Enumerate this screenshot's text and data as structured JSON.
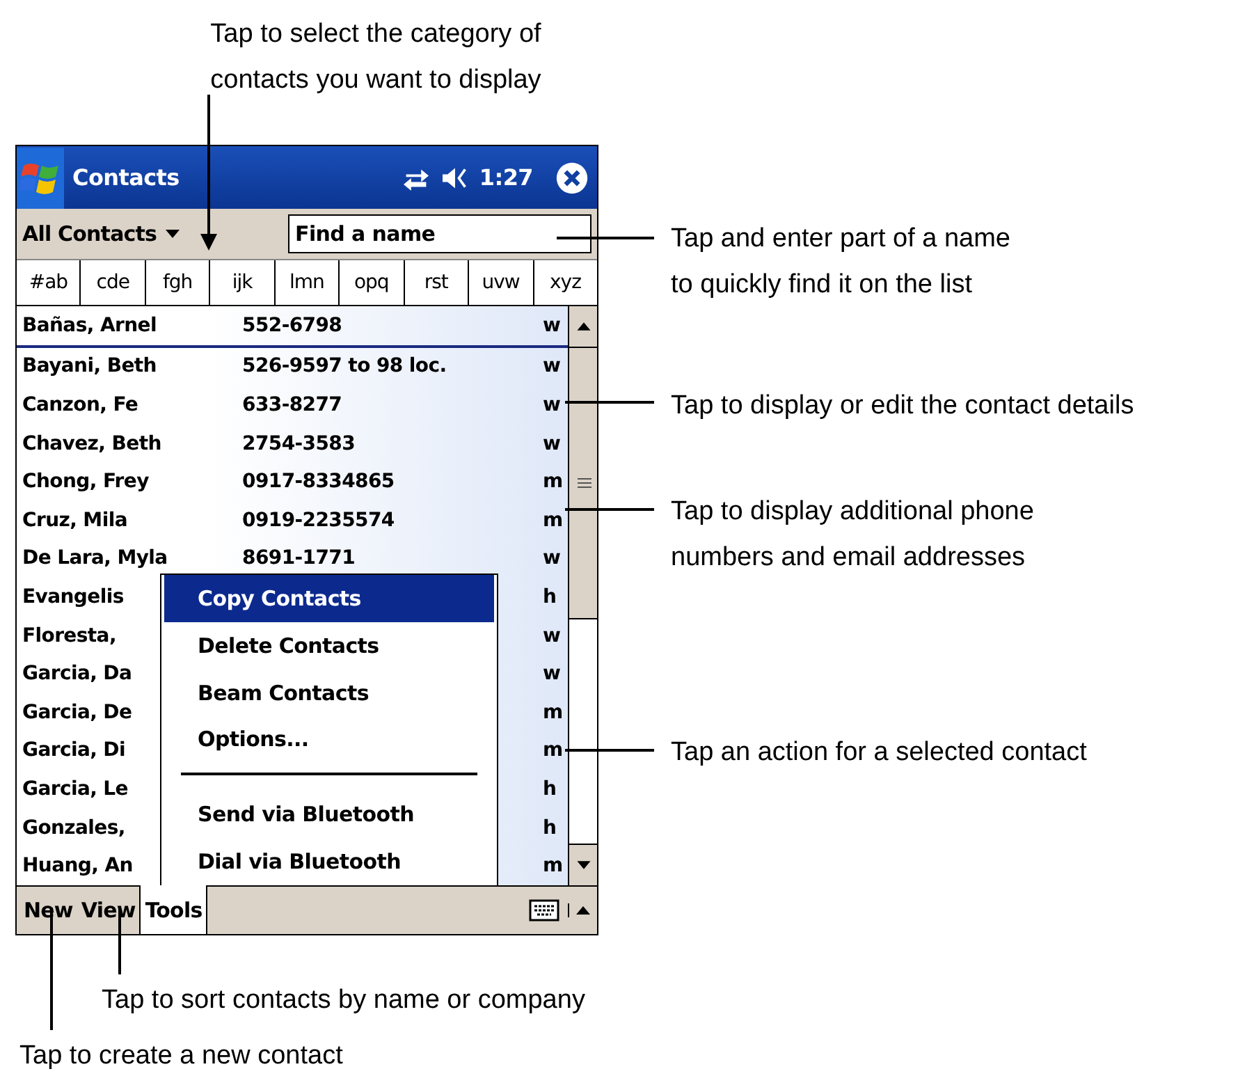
{
  "title_bar": {
    "title": "Contacts",
    "time": "1:27"
  },
  "filter": {
    "category": "All Contacts",
    "search": {
      "placeholder": "Find a name"
    }
  },
  "letter_tabs": [
    "#ab",
    "cde",
    "fgh",
    "ijk",
    "lmn",
    "opq",
    "rst",
    "uvw",
    "xyz"
  ],
  "contacts": [
    {
      "name": "Bañas, Arnel",
      "phone": "552-6798",
      "type": "w",
      "selected": true
    },
    {
      "name": "Bayani, Beth",
      "phone": "526-9597 to 98  loc.",
      "type": "w",
      "selected": false
    },
    {
      "name": "Canzon, Fe",
      "phone": "633-8277",
      "type": "w",
      "selected": false
    },
    {
      "name": "Chavez, Beth",
      "phone": "2754-3583",
      "type": "w",
      "selected": false
    },
    {
      "name": "Chong, Frey",
      "phone": "0917-8334865",
      "type": "m",
      "selected": false
    },
    {
      "name": "Cruz, Mila",
      "phone": "0919-2235574",
      "type": "m",
      "selected": false
    },
    {
      "name": "De Lara, Myla",
      "phone": "8691-1771",
      "type": "w",
      "selected": false
    },
    {
      "name": "Evangelis",
      "type": "h",
      "selected": false
    },
    {
      "name": "Floresta,",
      "type": "w",
      "selected": false
    },
    {
      "name": "Garcia, Da",
      "type": "w",
      "selected": false
    },
    {
      "name": "Garcia, De",
      "type": "m",
      "selected": false
    },
    {
      "name": "Garcia, Di",
      "type": "m",
      "selected": false
    },
    {
      "name": "Garcia, Le",
      "type": "h",
      "selected": false
    },
    {
      "name": "Gonzales,",
      "type": "h",
      "selected": false
    },
    {
      "name": "Huang, An",
      "type": "m",
      "selected": false
    }
  ],
  "menu": [
    {
      "kind": "item",
      "label": "Copy Contacts",
      "selected": true
    },
    {
      "kind": "item",
      "label": "Delete Contacts",
      "selected": false
    },
    {
      "kind": "item",
      "label": "Beam Contacts",
      "selected": false
    },
    {
      "kind": "item",
      "label": "Options...",
      "selected": false
    },
    {
      "kind": "separator"
    },
    {
      "kind": "item",
      "label": "Send via Bluetooth",
      "selected": false
    },
    {
      "kind": "item",
      "label": "Dial via Bluetooth",
      "selected": false
    }
  ],
  "command_bar": [
    {
      "label": "New",
      "selected": false
    },
    {
      "label": "View",
      "selected": false
    },
    {
      "label": "Tools",
      "selected": true
    }
  ],
  "callouts": [
    "Tap to select the category of\ncontacts you want to display",
    "Tap and enter part of a name\nto quickly find it on the list",
    "Tap to display or edit the contact details",
    "Tap to display additional phone\nnumbers and email addresses",
    "Tap an action for a selected contact",
    "Tap to sort contacts by name or company",
    "Tap to create a new contact"
  ]
}
